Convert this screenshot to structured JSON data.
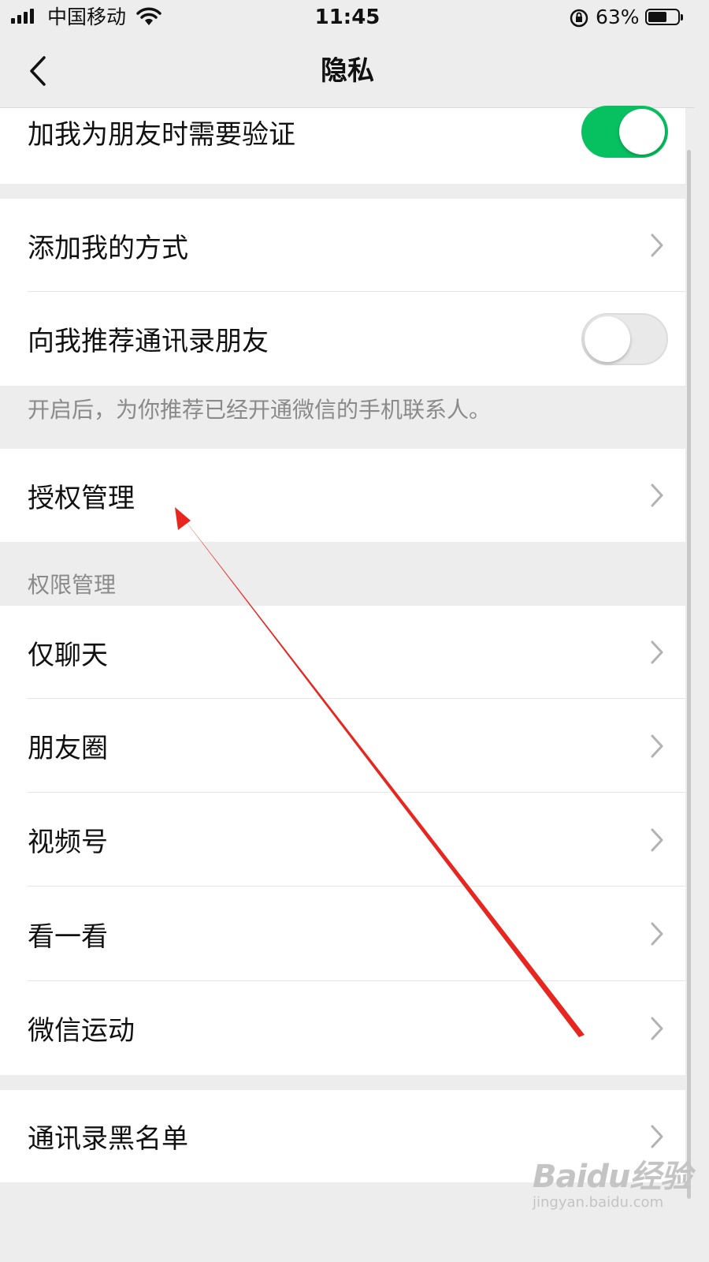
{
  "status_bar": {
    "carrier": "中国移动",
    "time": "11:45",
    "battery_percent": "63%",
    "battery_level": 0.63
  },
  "nav": {
    "title": "隐私",
    "back_icon": "chevron-left-icon"
  },
  "items": {
    "verify_friend": {
      "label": "加我为朋友时需要验证",
      "toggle_on": true
    },
    "add_me_method": {
      "label": "添加我的方式"
    },
    "recommend_contacts": {
      "label": "向我推荐通讯录朋友",
      "toggle_on": false
    },
    "recommend_hint": "开启后，为你推荐已经开通微信的手机联系人。",
    "auth_management": {
      "label": "授权管理"
    }
  },
  "permissions": {
    "section_title": "权限管理",
    "items": [
      {
        "label": "仅聊天"
      },
      {
        "label": "朋友圈"
      },
      {
        "label": "视频号"
      },
      {
        "label": "看一看"
      },
      {
        "label": "微信运动"
      }
    ]
  },
  "blacklist": {
    "label": "通讯录黑名单"
  },
  "watermark": {
    "logo": "Baidu经验",
    "url": "jingyan.baidu.com"
  },
  "colors": {
    "toggle_on": "#07c160",
    "annotation_arrow": "#e8251e",
    "background": "#ededed"
  }
}
